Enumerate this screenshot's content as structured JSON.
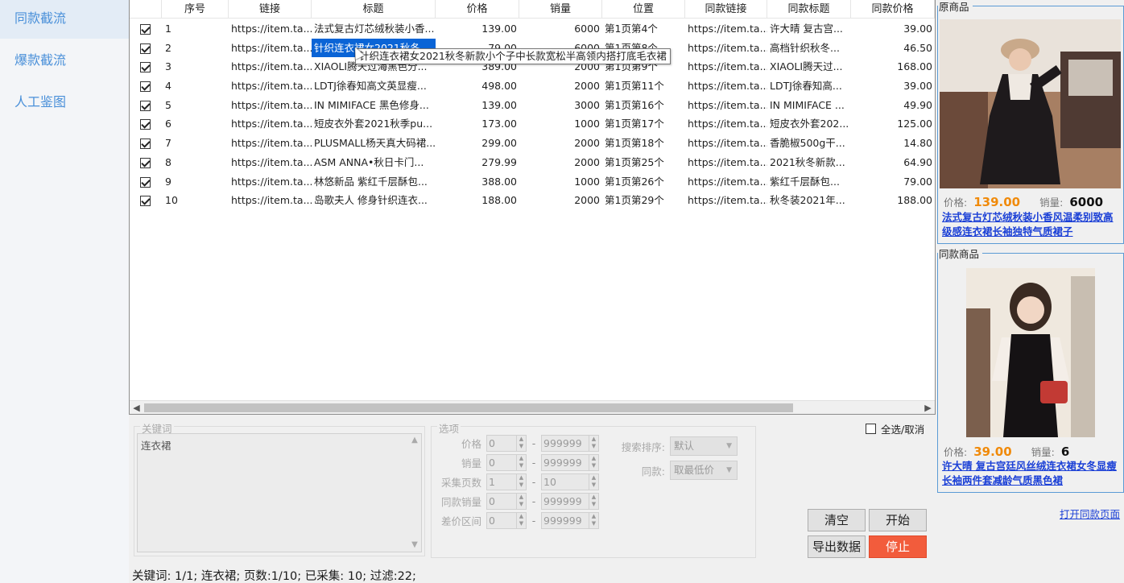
{
  "sidebar": {
    "items": [
      {
        "label": "同款截流",
        "active": true
      },
      {
        "label": "爆款截流",
        "active": false
      },
      {
        "label": "人工鉴图",
        "active": false
      }
    ]
  },
  "table": {
    "columns": [
      "",
      "序号",
      "链接",
      "标题",
      "价格",
      "销量",
      "位置",
      "同款链接",
      "同款标题",
      "同款价格"
    ],
    "rows": [
      {
        "checked": true,
        "no": "1",
        "link": "https://item.ta...",
        "title": "法式复古灯芯绒秋装小香...",
        "price": "139.00",
        "sales": "6000",
        "pos": "第1页第4个",
        "slink": "https://item.ta...",
        "stitle": "许大晴 复古宫...",
        "sprice": "39.00"
      },
      {
        "checked": true,
        "no": "2",
        "link": "https://item.ta...",
        "title": "针织连衣裙女2021秋冬...",
        "price": "79.00",
        "sales": "6000",
        "pos": "第1页第8个",
        "slink": "https://item.ta...",
        "stitle": "高档针织秋冬...",
        "sprice": "46.50"
      },
      {
        "checked": true,
        "no": "3",
        "link": "https://item.ta...",
        "title": "XIAOLI腾天过海黑色分...",
        "price": "389.00",
        "sales": "2000",
        "pos": "第1页第9个",
        "slink": "https://item.ta...",
        "stitle": "XIAOLI腾天过...",
        "sprice": "168.00"
      },
      {
        "checked": true,
        "no": "4",
        "link": "https://item.ta...",
        "title": "LDTJ徐春知高文英显瘦...",
        "price": "498.00",
        "sales": "2000",
        "pos": "第1页第11个",
        "slink": "https://item.ta...",
        "stitle": "LDTJ徐春知高...",
        "sprice": "39.00"
      },
      {
        "checked": true,
        "no": "5",
        "link": "https://item.ta...",
        "title": "IN MIMIFACE 黑色修身...",
        "price": "139.00",
        "sales": "3000",
        "pos": "第1页第16个",
        "slink": "https://item.ta...",
        "stitle": "IN MIMIFACE ...",
        "sprice": "49.90"
      },
      {
        "checked": true,
        "no": "6",
        "link": "https://item.ta...",
        "title": "短皮衣外套2021秋季pu...",
        "price": "173.00",
        "sales": "1000",
        "pos": "第1页第17个",
        "slink": "https://item.ta...",
        "stitle": "短皮衣外套202...",
        "sprice": "125.00"
      },
      {
        "checked": true,
        "no": "7",
        "link": "https://item.ta...",
        "title": "PLUSMALL杨天真大码裙...",
        "price": "299.00",
        "sales": "2000",
        "pos": "第1页第18个",
        "slink": "https://item.ta...",
        "stitle": "香脆椒500g干...",
        "sprice": "14.80"
      },
      {
        "checked": true,
        "no": "8",
        "link": "https://item.ta...",
        "title": "ASM ANNA•秋日卡门...",
        "price": "279.99",
        "sales": "2000",
        "pos": "第1页第25个",
        "slink": "https://item.ta...",
        "stitle": "2021秋冬新款...",
        "sprice": "64.90"
      },
      {
        "checked": true,
        "no": "9",
        "link": "https://item.ta...",
        "title": "林悠新品  紫红千层酥包...",
        "price": "388.00",
        "sales": "1000",
        "pos": "第1页第26个",
        "slink": "https://item.ta...",
        "stitle": "紫红千层酥包...",
        "sprice": "79.00"
      },
      {
        "checked": true,
        "no": "10",
        "link": "https://item.ta...",
        "title": "岛歌夫人 修身针织连衣...",
        "price": "188.00",
        "sales": "2000",
        "pos": "第1页第29个",
        "slink": "https://item.ta...",
        "stitle": "秋冬装2021年...",
        "sprice": "188.00"
      }
    ],
    "tooltip": "针织连衣裙女2021秋冬新款小个子中长款宽松半高领内搭打底毛衣裙"
  },
  "keywords": {
    "legend": "关键词",
    "text": "连衣裙"
  },
  "options": {
    "legend": "选项",
    "ranges": [
      {
        "label": "价格",
        "min": "0",
        "max": "999999"
      },
      {
        "label": "销量",
        "min": "0",
        "max": "999999"
      },
      {
        "label": "采集页数",
        "min": "1",
        "max": "10"
      },
      {
        "label": "同款销量",
        "min": "0",
        "max": "999999"
      },
      {
        "label": "差价区间",
        "min": "0",
        "max": "999999"
      }
    ],
    "sort_label": "搜索排序:",
    "sort_value": "默认",
    "same_label": "同款:",
    "same_value": "取最低价"
  },
  "select_all_label": "全选/取消",
  "buttons": {
    "clear": "清空",
    "start": "开始",
    "export": "导出数据",
    "stop": "停止"
  },
  "status_text": "关键词: 1/1; 连衣裙; 页数:1/10; 已采集: 10; 过滤:22;",
  "original": {
    "group_title": "原商品",
    "price_label": "价格:",
    "price": "139.00",
    "sales_label": "销量:",
    "sales": "6000",
    "title": "法式复古灯芯绒秋装小香风温柔别致高级感连衣裙长袖独特气质裙子"
  },
  "same": {
    "group_title": "同款商品",
    "price_label": "价格:",
    "price": "39.00",
    "sales_label": "销量:",
    "sales": "6",
    "title": "许大晴 复古宫廷风丝绒连衣裙女冬显瘦长袖两件套减龄气质黑色裙"
  },
  "open_same_link": "打开同款页面",
  "colors": {
    "accent": "#4a90d9",
    "selection": "#0a64d6",
    "price": "#f08a0a",
    "stop": "#f25c3c",
    "link": "#1a3fd6"
  }
}
